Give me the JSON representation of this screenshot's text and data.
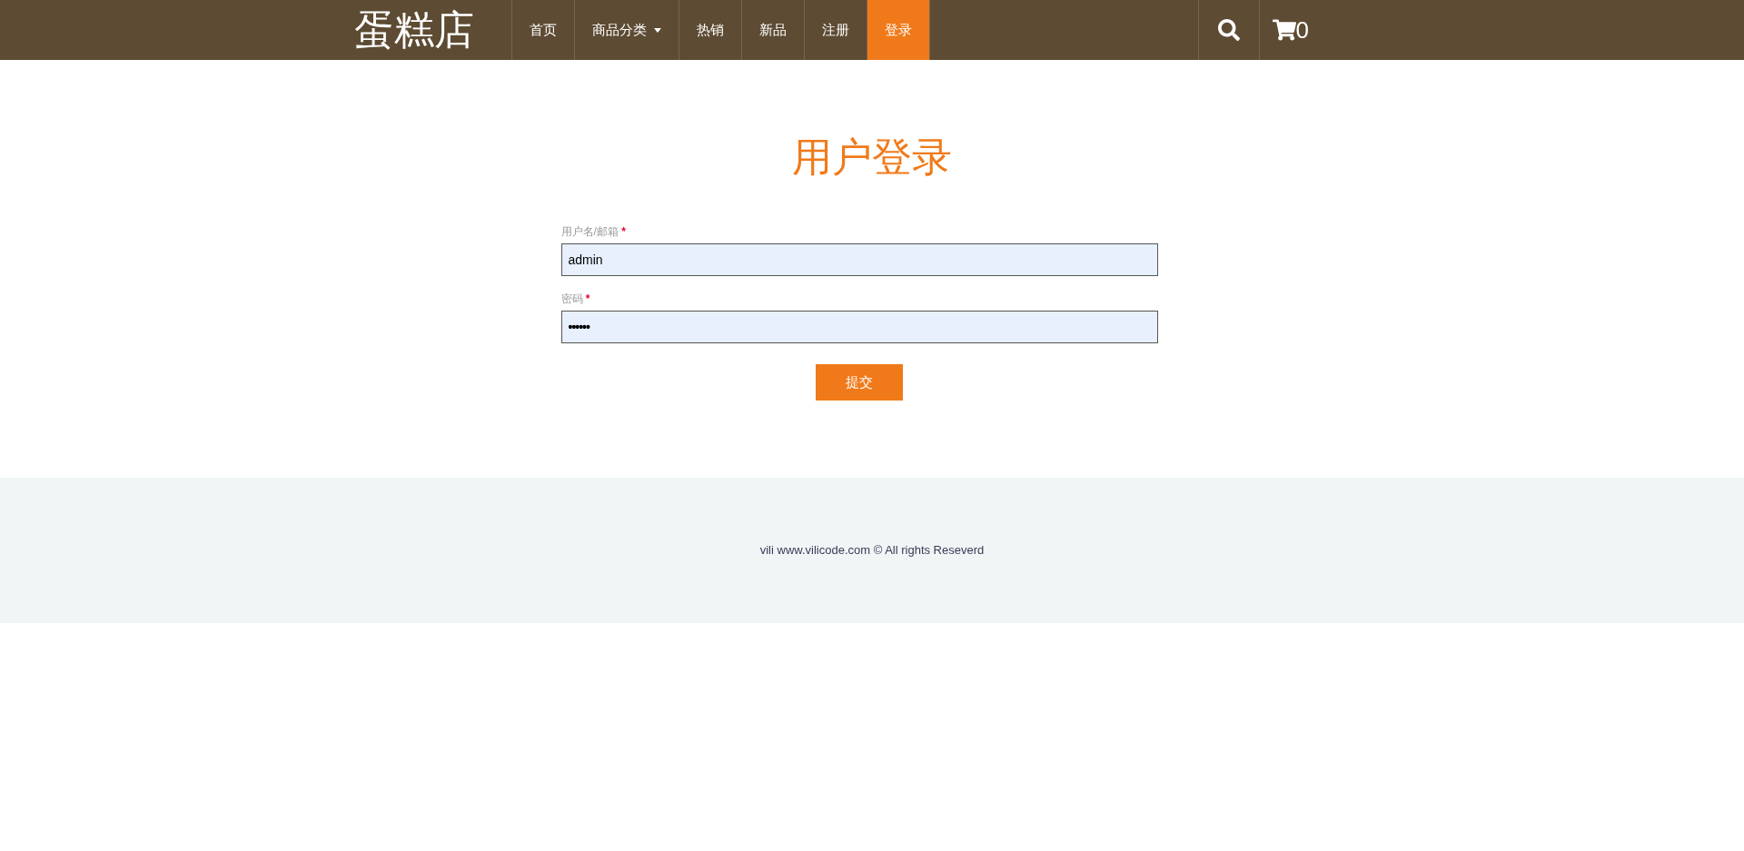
{
  "header": {
    "logo": "蛋糕店",
    "nav": [
      {
        "label": "首页",
        "selected": false,
        "dropdown": false
      },
      {
        "label": "商品分类",
        "selected": false,
        "dropdown": true
      },
      {
        "label": "热销",
        "selected": false,
        "dropdown": false
      },
      {
        "label": "新品",
        "selected": false,
        "dropdown": false
      },
      {
        "label": "注册",
        "selected": false,
        "dropdown": false
      },
      {
        "label": "登录",
        "selected": true,
        "dropdown": false
      }
    ],
    "cart_count": "0"
  },
  "login": {
    "title": "用户登录",
    "fields": [
      {
        "label": "用户名/邮箱",
        "required_mark": "*",
        "value": "admin",
        "kind": "text"
      },
      {
        "label": "密码",
        "required_mark": "*",
        "value": "••••••",
        "kind": "password"
      }
    ],
    "submit": "提交"
  },
  "footer": {
    "text": "vili www.vilicode.com © All rights Reseverd"
  }
}
